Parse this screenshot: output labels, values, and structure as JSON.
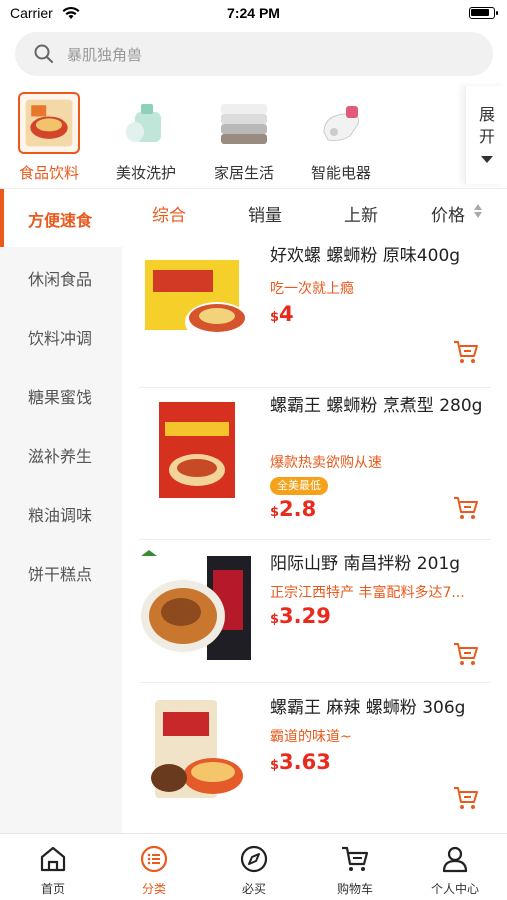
{
  "status_bar": {
    "carrier": "Carrier",
    "time": "7:24 PM"
  },
  "search": {
    "placeholder": "暴肌独角兽"
  },
  "categories": [
    {
      "label": "食品饮料",
      "active": true
    },
    {
      "label": "美妆洗护",
      "active": false
    },
    {
      "label": "家居生活",
      "active": false
    },
    {
      "label": "智能电器",
      "active": false
    }
  ],
  "expand_label": "展开",
  "sidebar": {
    "items": [
      "方便速食",
      "休闲食品",
      "饮料冲调",
      "糖果蜜饯",
      "滋补养生",
      "粮油调味",
      "饼干糕点"
    ],
    "active_index": 0
  },
  "sort": {
    "items": [
      "综合",
      "销量",
      "上新",
      "价格"
    ],
    "active_index": 0
  },
  "products": [
    {
      "name": "好欢螺 螺蛳粉 原味400g",
      "desc": "吃一次就上瘾",
      "tag": "",
      "currency": "$",
      "price": "4"
    },
    {
      "name": "螺霸王 螺蛳粉 烹煮型 280g",
      "desc": "爆款热卖欲购从速",
      "tag": "全美最低",
      "currency": "$",
      "price": "2.8"
    },
    {
      "name": "阳际山野 南昌拌粉 201g",
      "desc": "正宗江西特产 丰富配料多达7...",
      "tag": "",
      "currency": "$",
      "price": "3.29"
    },
    {
      "name": "螺霸王 麻辣 螺蛳粉 306g",
      "desc": "霸道的味道~",
      "tag": "",
      "currency": "$",
      "price": "3.63"
    }
  ],
  "tabbar": {
    "items": [
      {
        "label": "首页",
        "icon": "home-icon"
      },
      {
        "label": "分类",
        "icon": "category-icon"
      },
      {
        "label": "必买",
        "icon": "compass-icon"
      },
      {
        "label": "购物车",
        "icon": "cart-icon"
      },
      {
        "label": "个人中心",
        "icon": "profile-icon"
      }
    ],
    "active_index": 1
  },
  "colors": {
    "accent": "#ea5a1c",
    "price": "#ea2a1c",
    "tag": "#f5a21b"
  }
}
